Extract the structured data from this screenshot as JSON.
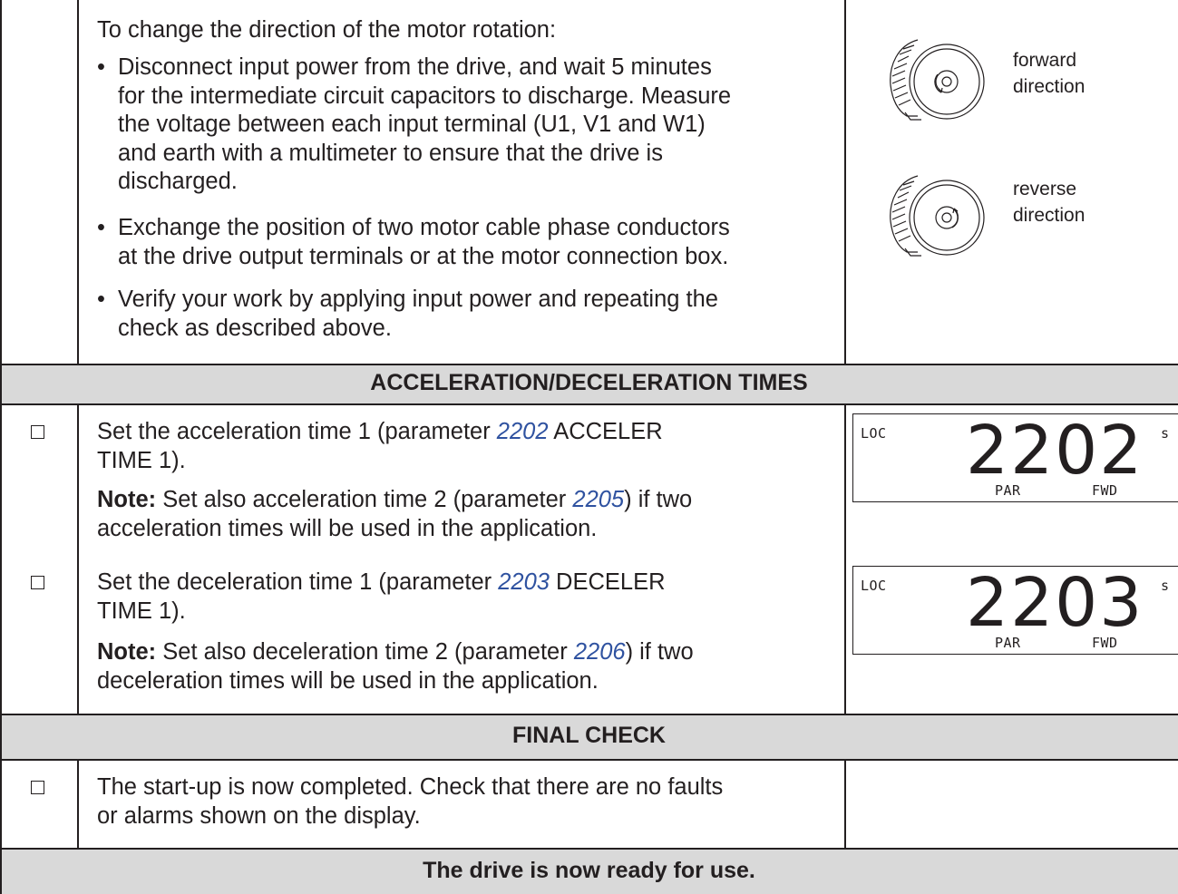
{
  "intro": {
    "heading": "To change the direction of the motor rotation:",
    "bullets": [
      [
        "Disconnect input power from the drive, and wait 5 minutes",
        "for the intermediate circuit capacitors to discharge. Measure",
        "the voltage between each input terminal (U1, V1 and W1)",
        "and earth with a multimeter to ensure that the drive is",
        "discharged."
      ],
      [
        "Exchange the position of two motor cable phase conductors",
        "at the drive output terminals or at the motor connection box."
      ],
      [
        "Verify your work by applying input power and repeating the",
        "check as described above."
      ]
    ],
    "bullet_char": "•",
    "motor_forward_label": [
      "forward",
      "direction"
    ],
    "motor_reverse_label": [
      "reverse",
      "direction"
    ]
  },
  "sections": {
    "accel": "ACCELERATION/DECELERATION TIMES",
    "final": "FINAL CHECK",
    "ready": "The drive is now ready for use."
  },
  "accel_rows": [
    {
      "line1_pre": "Set the acceleration time 1 (parameter ",
      "param": "2202",
      "line1_post": " ACCELER",
      "line2": "TIME 1).",
      "note_label": "Note:",
      "note_pre": " Set also acceleration time 2 (parameter ",
      "note_param": "2205",
      "note_post": ") if two",
      "note_line2": "acceleration times will be used in the application.",
      "display": {
        "loc": "LOC",
        "value": "2202",
        "unit": "s",
        "par": "PAR",
        "fwd": "FWD"
      }
    },
    {
      "line1_pre": "Set the deceleration time 1 (parameter ",
      "param": "2203",
      "line1_post": " DECELER",
      "line2": "TIME 1).",
      "note_label": "Note:",
      "note_pre": " Set also deceleration time 2 (parameter ",
      "note_param": "2206",
      "note_post": ") if two",
      "note_line2": "deceleration times will be used in the application.",
      "display": {
        "loc": "LOC",
        "value": "2203",
        "unit": "s",
        "par": "PAR",
        "fwd": "FWD"
      }
    }
  ],
  "final_row": {
    "lines": [
      "The start-up is now completed. Check that there are no faults",
      "or alarms shown on the display."
    ]
  },
  "colors": {
    "band": "#d9d9d9",
    "link": "#2f52a0",
    "ink": "#231f20"
  },
  "icons": [
    "checkbox-icon",
    "motor-forward-icon",
    "motor-reverse-icon"
  ]
}
